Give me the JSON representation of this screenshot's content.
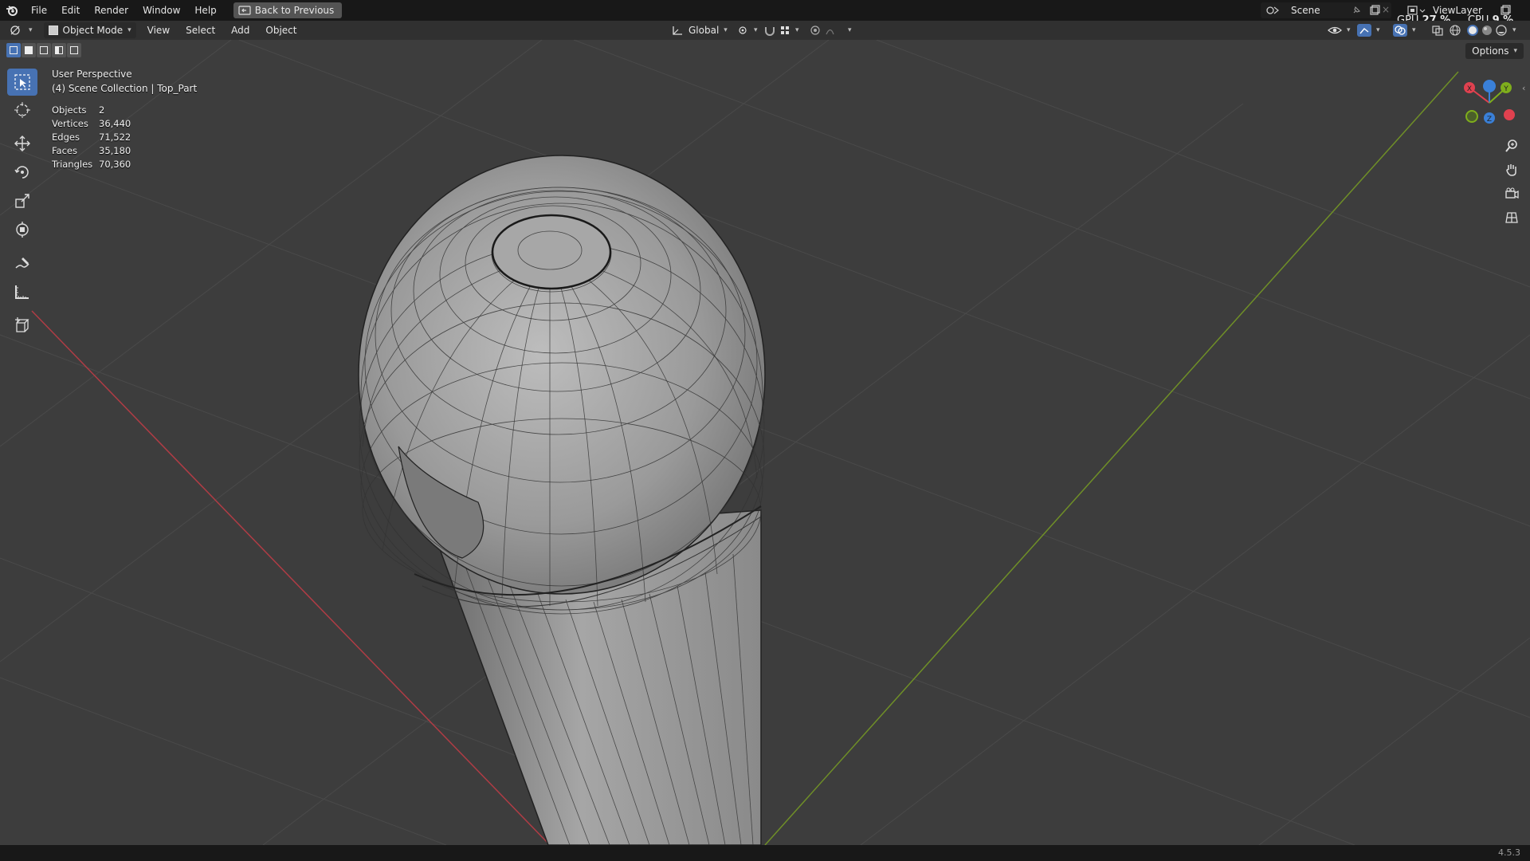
{
  "menubar": {
    "items": [
      "File",
      "Edit",
      "Render",
      "Window",
      "Help"
    ],
    "back_button": "Back to Previous",
    "scene_label": "Scene",
    "viewlayer_label": "ViewLayer",
    "gpu_label": "GPU",
    "gpu_value": "27 %",
    "cpu_label": "CPU",
    "cpu_value": "9 %"
  },
  "viewport_header": {
    "mode": "Object Mode",
    "menus": [
      "View",
      "Select",
      "Add",
      "Object"
    ],
    "transform_orientation": "Global",
    "options_label": "Options"
  },
  "overlay": {
    "view_name": "User Perspective",
    "collection": "(4) Scene Collection | Top_Part",
    "stats": [
      {
        "label": "Objects",
        "value": "2"
      },
      {
        "label": "Vertices",
        "value": "36,440"
      },
      {
        "label": "Edges",
        "value": "71,522"
      },
      {
        "label": "Faces",
        "value": "35,180"
      },
      {
        "label": "Triangles",
        "value": "70,360"
      }
    ]
  },
  "gizmo": {
    "x": "X",
    "y": "Y",
    "z": "Z"
  },
  "toolbar_tools": [
    "select-box-tool",
    "cursor-tool",
    "move-tool",
    "rotate-tool",
    "scale-tool",
    "transform-tool",
    "annotate-tool",
    "measure-tool",
    "add-cube-tool"
  ],
  "statusbar": {
    "version": "4.5.3"
  },
  "colors": {
    "accent": "#4772b3",
    "axis_x": "#e0414f",
    "axis_y": "#7fae1c",
    "axis_z": "#3a80d8",
    "viewport_bg": "#3d3d3d"
  }
}
